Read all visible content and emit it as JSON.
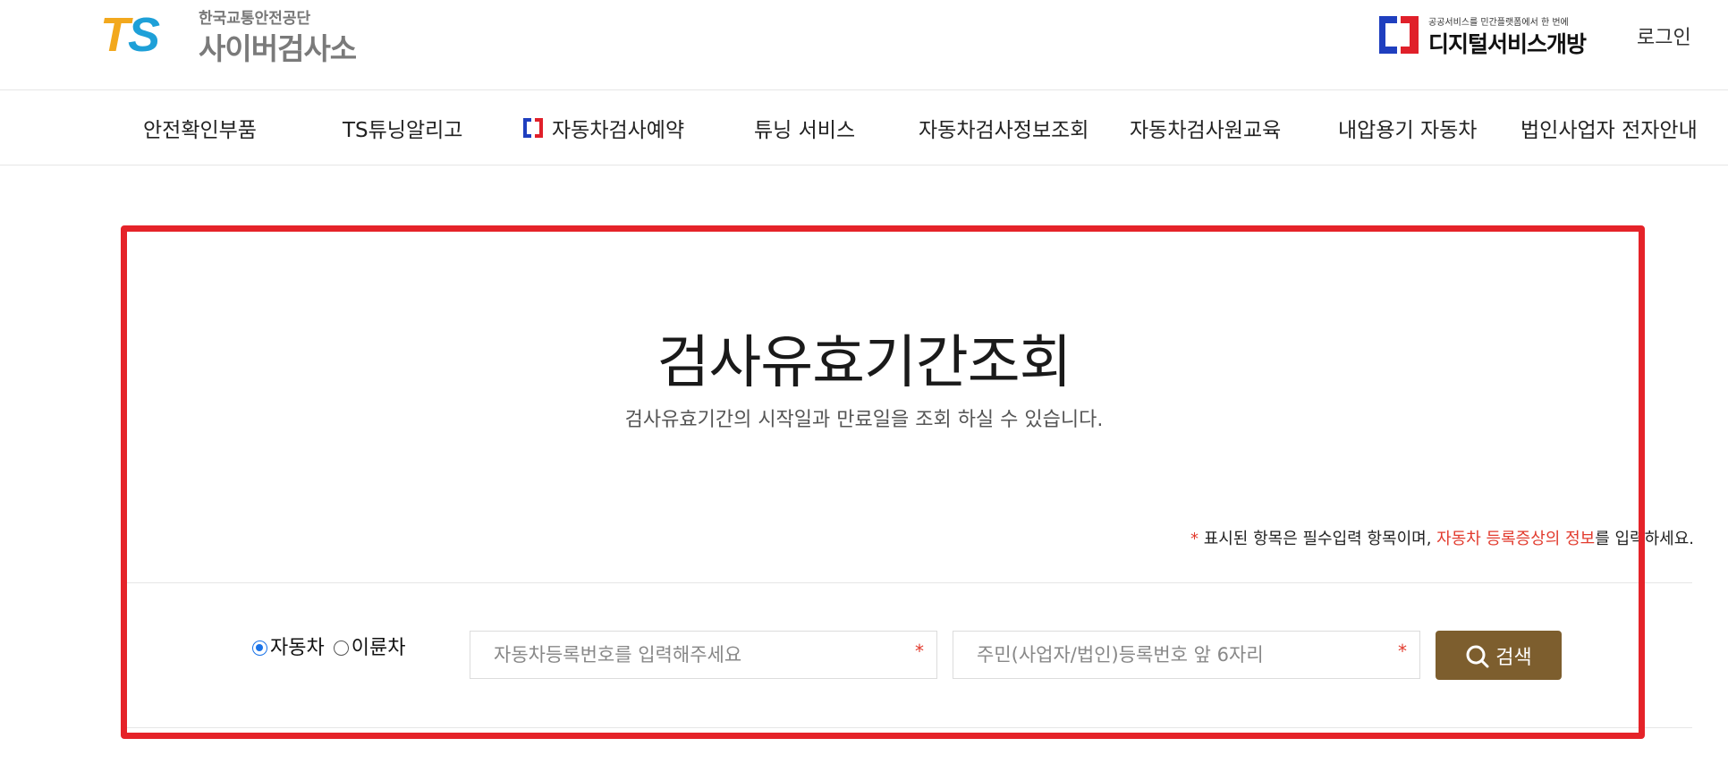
{
  "header": {
    "logo_mark": "TS",
    "org_name": "한국교통안전공단",
    "site_name": "사이버검사소",
    "digital_service_small": "공공서비스를 민간플랫폼에서 한 번에",
    "digital_service_big": "디지털서비스개방",
    "login_label": "로그인"
  },
  "nav": {
    "items": [
      {
        "label": "안전확인부품"
      },
      {
        "label": "TS튜닝알리고"
      },
      {
        "label": "자동차검사예약",
        "icon": "digital-service-icon"
      },
      {
        "label": "튜닝 서비스"
      },
      {
        "label": "자동차검사정보조회"
      },
      {
        "label": "자동차검사원교육"
      },
      {
        "label": "내압용기 자동차"
      },
      {
        "label": "법인사업자 전자안내"
      }
    ]
  },
  "main": {
    "title": "검사유효기간조회",
    "subtitle": "검사유효기간의 시작일과 만료일을 조회 하실 수 있습니다.",
    "notice": {
      "asterisk": "*",
      "text_before": " 표시된 항목은 필수입력 항목이며, ",
      "highlight": "자동차 등록증상의 정보",
      "text_after": "를 입력하세요."
    },
    "vehicle_type": {
      "options": [
        {
          "label": "자동차",
          "checked": true
        },
        {
          "label": "이륜차",
          "checked": false
        }
      ]
    },
    "fields": {
      "registration_number": {
        "placeholder": "자동차등록번호를 입력해주세요",
        "value": "",
        "required_mark": "*"
      },
      "id_number": {
        "placeholder": "주민(사업자/법인)등록번호 앞 6자리",
        "value": "",
        "required_mark": "*"
      }
    },
    "search_button_label": "검색"
  },
  "colors": {
    "highlight_box": "#e52329",
    "search_button": "#7d5e2e",
    "required": "#e23b2e",
    "radio_selected": "#1a73e8",
    "ts_orange": "#f2a81d",
    "ts_blue": "#1ea0d8"
  }
}
